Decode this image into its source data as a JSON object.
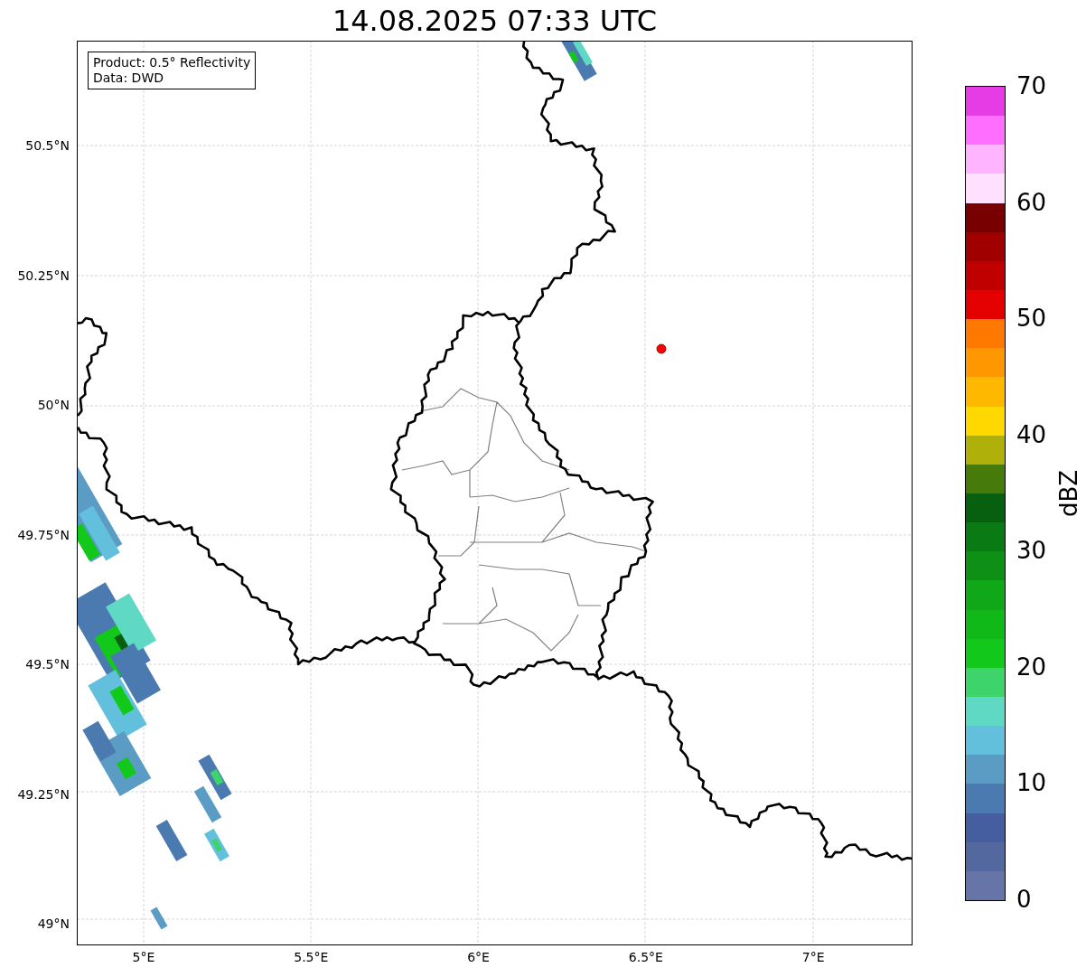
{
  "title": "14.08.2025 07:33 UTC",
  "info_box": {
    "lines": [
      "Product: 0.5° Reflectivity",
      "Data: DWD"
    ]
  },
  "map": {
    "lat_ticks": [
      "50.5°N",
      "50.25°N",
      "50°N",
      "49.75°N",
      "49.5°N",
      "49.25°N",
      "49°N"
    ],
    "lon_ticks": [
      "5°E",
      "5.5°E",
      "6°E",
      "6.5°E",
      "7°E"
    ]
  },
  "colorbar": {
    "label": "dBZ",
    "ticks": [
      "70",
      "60",
      "50",
      "40",
      "30",
      "20",
      "10",
      "0"
    ],
    "segments": [
      {
        "color": "#6674a8"
      },
      {
        "color": "#5468a0"
      },
      {
        "color": "#445ea0"
      },
      {
        "color": "#4a7ab0"
      },
      {
        "color": "#5a9cc4"
      },
      {
        "color": "#62c0dc"
      },
      {
        "color": "#5fd8c4"
      },
      {
        "color": "#3ed46c"
      },
      {
        "color": "#12c81a"
      },
      {
        "color": "#10b818"
      },
      {
        "color": "#10a818"
      },
      {
        "color": "#0e9016"
      },
      {
        "color": "#0a7a14"
      },
      {
        "color": "#076010"
      },
      {
        "color": "#467a0a"
      },
      {
        "color": "#b0b00a"
      },
      {
        "color": "#ffd800"
      },
      {
        "color": "#ffb800"
      },
      {
        "color": "#ff9800"
      },
      {
        "color": "#ff7800"
      },
      {
        "color": "#e40000"
      },
      {
        "color": "#c00000"
      },
      {
        "color": "#a00000"
      },
      {
        "color": "#780000"
      },
      {
        "color": "#ffe0ff"
      },
      {
        "color": "#ffb4ff"
      },
      {
        "color": "#ff6eff"
      },
      {
        "color": "#e63ce6"
      }
    ]
  }
}
